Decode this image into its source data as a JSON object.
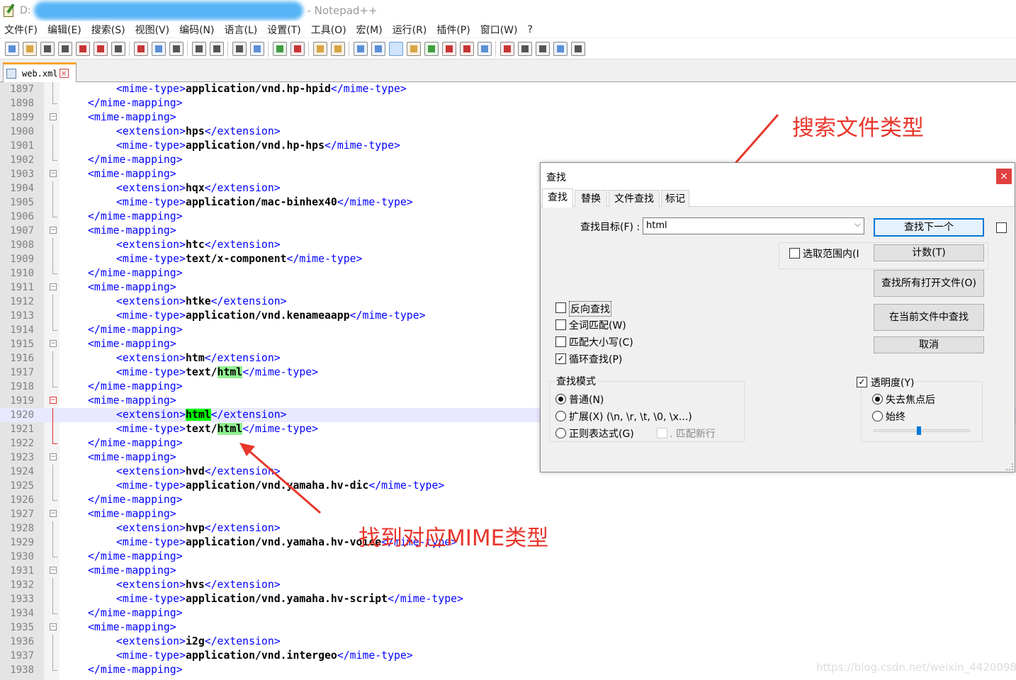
{
  "window": {
    "title_prefix": "D:",
    "app_name": "- Notepad++"
  },
  "menu": [
    "文件(F)",
    "编辑(E)",
    "搜索(S)",
    "视图(V)",
    "编码(N)",
    "语言(L)",
    "设置(T)",
    "工具(O)",
    "宏(M)",
    "运行(R)",
    "插件(P)",
    "窗口(W)",
    "?"
  ],
  "tab": {
    "label": "web.xml"
  },
  "editor": {
    "lines": [
      {
        "n": "1897",
        "indent": 2,
        "open": "<mime-type>",
        "text": "application/vnd.hp-hpid",
        "close": "</mime-type>"
      },
      {
        "n": "1898",
        "indent": 1,
        "open": "</mime-mapping>"
      },
      {
        "n": "1899",
        "indent": 1,
        "open": "<mime-mapping>"
      },
      {
        "n": "1900",
        "indent": 2,
        "open": "<extension>",
        "text": "hps",
        "close": "</extension>"
      },
      {
        "n": "1901",
        "indent": 2,
        "open": "<mime-type>",
        "text": "application/vnd.hp-hps",
        "close": "</mime-type>"
      },
      {
        "n": "1902",
        "indent": 1,
        "open": "</mime-mapping>"
      },
      {
        "n": "1903",
        "indent": 1,
        "open": "<mime-mapping>"
      },
      {
        "n": "1904",
        "indent": 2,
        "open": "<extension>",
        "text": "hqx",
        "close": "</extension>"
      },
      {
        "n": "1905",
        "indent": 2,
        "open": "<mime-type>",
        "text": "application/mac-binhex40",
        "close": "</mime-type>"
      },
      {
        "n": "1906",
        "indent": 1,
        "open": "</mime-mapping>"
      },
      {
        "n": "1907",
        "indent": 1,
        "open": "<mime-mapping>"
      },
      {
        "n": "1908",
        "indent": 2,
        "open": "<extension>",
        "text": "htc",
        "close": "</extension>"
      },
      {
        "n": "1909",
        "indent": 2,
        "open": "<mime-type>",
        "text": "text/x-component",
        "close": "</mime-type>"
      },
      {
        "n": "1910",
        "indent": 1,
        "open": "</mime-mapping>"
      },
      {
        "n": "1911",
        "indent": 1,
        "open": "<mime-mapping>"
      },
      {
        "n": "1912",
        "indent": 2,
        "open": "<extension>",
        "text": "htke",
        "close": "</extension>"
      },
      {
        "n": "1913",
        "indent": 2,
        "open": "<mime-type>",
        "text": "application/vnd.kenameaapp",
        "close": "</mime-type>"
      },
      {
        "n": "1914",
        "indent": 1,
        "open": "</mime-mapping>"
      },
      {
        "n": "1915",
        "indent": 1,
        "open": "<mime-mapping>"
      },
      {
        "n": "1916",
        "indent": 2,
        "open": "<extension>",
        "text": "htm",
        "close": "</extension>"
      },
      {
        "n": "1917",
        "indent": 2,
        "open": "<mime-type>",
        "text": "text/",
        "match": "html",
        "close": "</mime-type>"
      },
      {
        "n": "1918",
        "indent": 1,
        "open": "</mime-mapping>"
      },
      {
        "n": "1919",
        "indent": 1,
        "open": "<mime-mapping>"
      },
      {
        "n": "1920",
        "indent": 2,
        "open": "<extension>",
        "match": "html",
        "close": "</extension>"
      },
      {
        "n": "1921",
        "indent": 2,
        "open": "<mime-type>",
        "text": "text/",
        "match": "html",
        "close": "</mime-type>"
      },
      {
        "n": "1922",
        "indent": 1,
        "open": "</mime-mapping>"
      },
      {
        "n": "1923",
        "indent": 1,
        "open": "<mime-mapping>"
      },
      {
        "n": "1924",
        "indent": 2,
        "open": "<extension>",
        "text": "hvd",
        "close": "</extension>"
      },
      {
        "n": "1925",
        "indent": 2,
        "open": "<mime-type>",
        "text": "application/vnd.yamaha.hv-dic",
        "close": "</mime-type>"
      },
      {
        "n": "1926",
        "indent": 1,
        "open": "</mime-mapping>"
      },
      {
        "n": "1927",
        "indent": 1,
        "open": "<mime-mapping>"
      },
      {
        "n": "1928",
        "indent": 2,
        "open": "<extension>",
        "text": "hvp",
        "close": "</extension>"
      },
      {
        "n": "1929",
        "indent": 2,
        "open": "<mime-type>",
        "text": "application/vnd.yamaha.hv-voice",
        "close": "</mime-type>"
      },
      {
        "n": "1930",
        "indent": 1,
        "open": "</mime-mapping>"
      },
      {
        "n": "1931",
        "indent": 1,
        "open": "<mime-mapping>"
      },
      {
        "n": "1932",
        "indent": 2,
        "open": "<extension>",
        "text": "hvs",
        "close": "</extension>"
      },
      {
        "n": "1933",
        "indent": 2,
        "open": "<mime-type>",
        "text": "application/vnd.yamaha.hv-script",
        "close": "</mime-type>"
      },
      {
        "n": "1934",
        "indent": 1,
        "open": "</mime-mapping>"
      },
      {
        "n": "1935",
        "indent": 1,
        "open": "<mime-mapping>"
      },
      {
        "n": "1936",
        "indent": 2,
        "open": "<extension>",
        "text": "i2g",
        "close": "</extension>"
      },
      {
        "n": "1937",
        "indent": 2,
        "open": "<mime-type>",
        "text": "application/vnd.intergeo",
        "close": "</mime-type>"
      },
      {
        "n": "1938",
        "indent": 1,
        "open": "</mime-mapping>"
      }
    ]
  },
  "find_dialog": {
    "title": "查找",
    "close": "×",
    "tabs": [
      "查找",
      "替换",
      "文件查找",
      "标记"
    ],
    "target_label": "查找目标(F) :",
    "target_value": "html",
    "in_selection": "选取范围内(I",
    "buttons": {
      "find_next": "查找下一个",
      "count": "计数(T)",
      "find_all_open": "查找所有打开文件(O)",
      "find_all_current": "在当前文件中查找",
      "cancel": "取消"
    },
    "options": {
      "backward": "反向查找",
      "whole_word": "全词匹配(W)",
      "match_case": "匹配大小写(C)",
      "wrap": "循环查找(P)"
    },
    "mode": {
      "title": "查找模式",
      "normal": "普通(N)",
      "extended": "扩展(X) (\\n, \\r, \\t, \\0, \\x...)",
      "regex": "正则表达式(G)",
      "newline": ". 匹配新行"
    },
    "transparency": {
      "label": "透明度(Y)",
      "on_lose_focus": "失去焦点后",
      "always": "始终",
      "level": 0.45
    }
  },
  "annotations": {
    "search_type": "搜索文件类型",
    "found_mime": "找到对应MIME类型"
  },
  "watermark": "https://blog.csdn.net/weixin_44200984",
  "colors": {
    "tag": "#0000ff",
    "match_bg": "#8fef8f",
    "arrow": "#e8372c"
  }
}
